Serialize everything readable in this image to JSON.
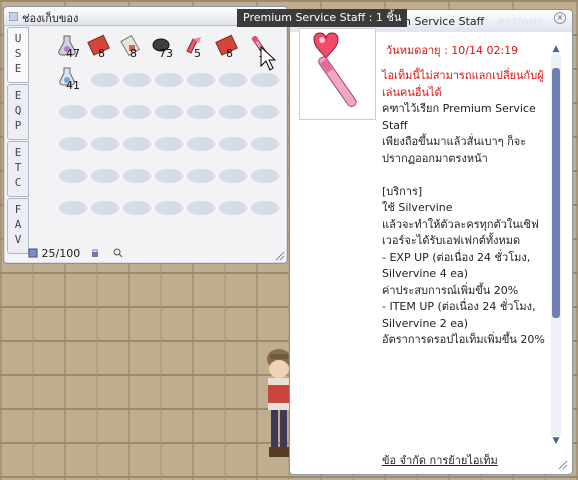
{
  "inventory": {
    "title": "ช่องเก็บของ",
    "tabs": [
      "USE",
      "EQP",
      "ETC",
      "FAV"
    ],
    "active_tab": "USE",
    "items": [
      {
        "icon": "potion-flask-icon",
        "qty": "47"
      },
      {
        "icon": "red-book-icon",
        "qty": "8"
      },
      {
        "icon": "scroll-icon",
        "qty": "8"
      },
      {
        "icon": "dark-ore-icon",
        "qty": "73"
      },
      {
        "icon": "pink-ribbon-icon",
        "qty": "5"
      },
      {
        "icon": "red-book-icon",
        "qty": "8"
      },
      {
        "icon": "staff-icon",
        "qty": "1"
      },
      {
        "icon": "blue-potion-icon",
        "qty": "41"
      }
    ],
    "capacity": "25/100"
  },
  "tooltip": {
    "text": "Premium Service Staff : 1 ชิ้น"
  },
  "description": {
    "title": "Premium Service Staff",
    "watermark": "ections",
    "expire": "วันหมดอายุ : 10/14 02:19",
    "warning": "ไอเท็มนี้ไม่สามารถแลกเปลี่ยนกับผู้เล่นคนอื่นได้",
    "lines": [
      "คฑาไว้เรียก Premium Service Staff",
      "เพียงถือขึ้นมาแล้วสั่นเบาๆ ก็จะปรากฏออกมาตรงหน้า",
      "",
      "[บริการ]",
      "ใช้ Silvervine",
      "แล้วจะทำให้ตัวละครทุกตัวในเซิฟเวอร์จะได้รับเอฟเฟกต์ทั้งหมด",
      "- EXP UP (ต่อเนื่อง 24 ชั่วโมง, Silvervine 4 ea)",
      "ค่าประสบการณ์เพิ่มขึ้น 20%",
      "- ITEM UP (ต่อเนื่อง 24 ชั่วโมง, Silvervine 2 ea)",
      "อัตราการดรอปไอเท็มเพิ่มขึ้น 20%"
    ],
    "footer": "ข้อ จำกัด การย้ายไอเท็ม"
  }
}
